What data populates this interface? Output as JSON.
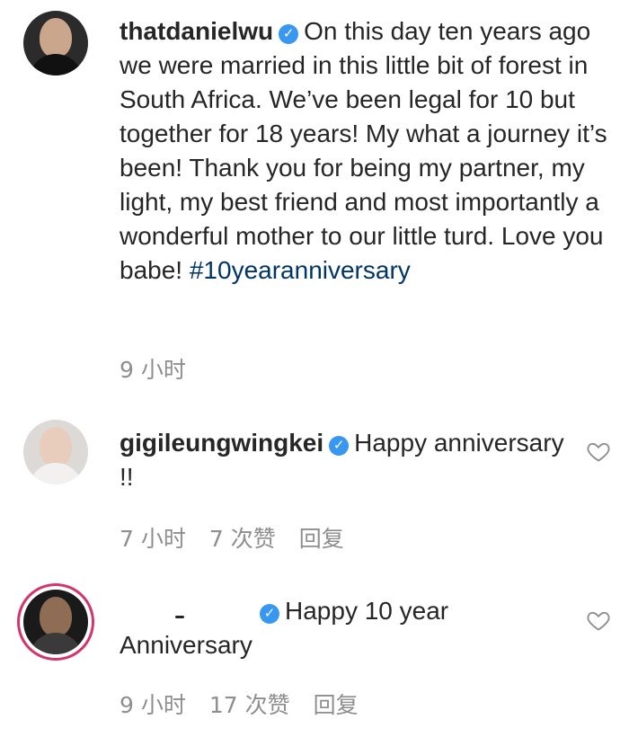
{
  "comments": [
    {
      "username": "thatdanielwu",
      "text": "On this day ten years ago we were married in this little bit of forest in South Africa. We’ve been legal for 10 but together for 18 years! My what a journey it’s been! Thank you for being my partner, my light, my best friend and most importantly a wonderful mother to our little turd. Love you babe! ",
      "hashtag": "#10yearanniversary",
      "time": "9 小时"
    },
    {
      "username": "gigileungwingkei",
      "text": "Happy anniversary !!",
      "time": "7 小时",
      "likes": "7 次赞",
      "reply": "回复"
    },
    {
      "username": "",
      "text": "Happy 10 year Anniversary",
      "time": "9 小时",
      "likes": "17 次赞",
      "reply": "回复"
    }
  ],
  "icons": {
    "verified": "verified-badge-icon",
    "like": "heart-outline-icon"
  },
  "colors": {
    "verified": "#3897f0",
    "hashtag": "#003569",
    "meta": "#8e8e8e",
    "story_ring": "#d6336c"
  }
}
